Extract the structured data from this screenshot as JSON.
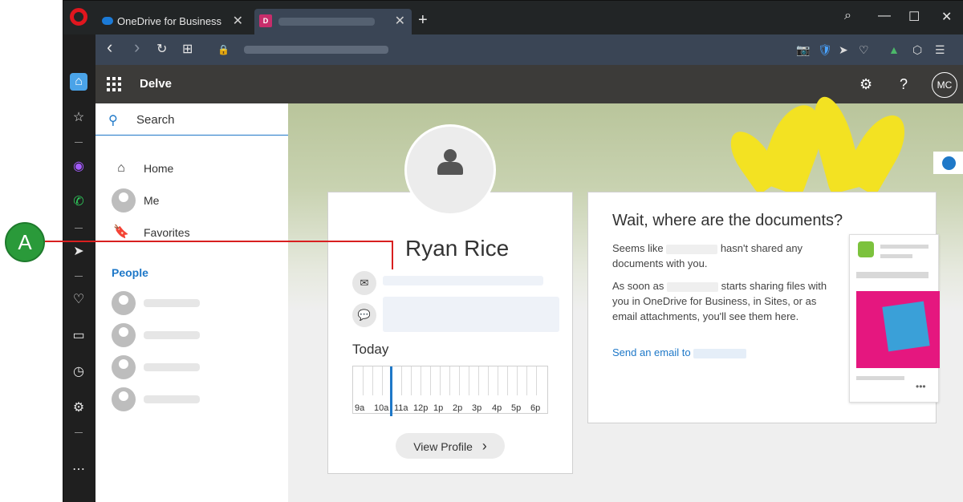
{
  "browser": {
    "tabs": [
      {
        "label": "OneDrive for Business",
        "favicon": "onedrive-cloud-icon"
      },
      {
        "label": "",
        "favicon": "delve-icon",
        "favicon_text": "D"
      }
    ],
    "new_tab": "+",
    "window_controls": {
      "search": "⌕",
      "minimize": "—",
      "maximize": "☐",
      "close": "✕"
    },
    "nav": {
      "back": "‹",
      "forward": "›",
      "reload": "↻",
      "speed_dial": "⊞",
      "lock": "🔒"
    },
    "right_icons": [
      "📷",
      "🛡",
      "➤",
      "♡",
      "▲",
      "⬡",
      "☰"
    ],
    "sidebar_icons": [
      "⌂",
      "☆",
      "◉",
      "✆",
      "➤",
      "♡",
      "▭",
      "◷",
      "⚙",
      "⋯"
    ]
  },
  "suite": {
    "app_name": "Delve",
    "settings_icon": "⚙",
    "help_icon": "?",
    "avatar_initials": "MC"
  },
  "leftnav": {
    "search_placeholder": "Search",
    "items": [
      {
        "label": "Home",
        "icon": "⌂"
      },
      {
        "label": "Me",
        "icon": ""
      },
      {
        "label": "Favorites",
        "icon": "🔖"
      }
    ],
    "people_title": "People"
  },
  "profile": {
    "name": "Ryan Rice",
    "email_icon": "✉",
    "chat_icon": "💬",
    "today_label": "Today",
    "timeline_labels": [
      "9a",
      "10a",
      "11a",
      "12p",
      "1p",
      "2p",
      "3p",
      "4p",
      "5p",
      "6p"
    ],
    "view_profile_label": "View Profile",
    "view_profile_chevron": "›"
  },
  "docs": {
    "title": "Wait, where are the documents?",
    "para1_a": "Seems like",
    "para1_b": "hasn't shared any documents with you.",
    "para2_a": "As soon as",
    "para2_b": "starts sharing files with you in OneDrive for Business, in Sites, or as email attachments, you'll see them here.",
    "link": "Send an email to",
    "mock_dots": "•••"
  },
  "annotation": {
    "label": "A"
  },
  "colors": {
    "accent": "#1e78c8",
    "annotation_green": "#2a9a3a",
    "annotation_line": "#d81f1f"
  }
}
